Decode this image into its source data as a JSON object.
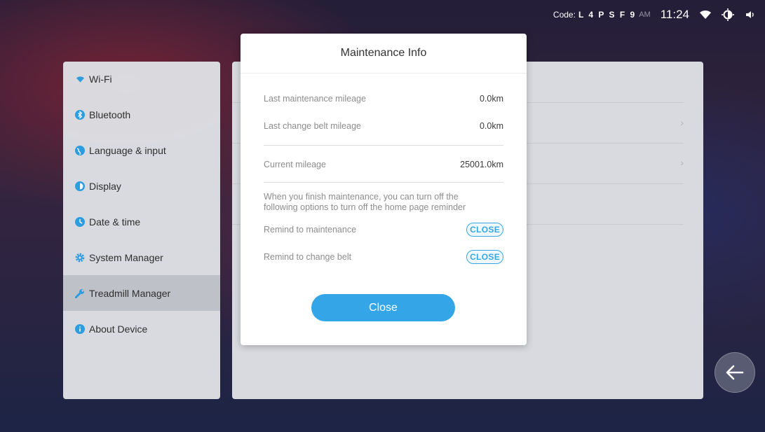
{
  "status_bar": {
    "code_label": "Code:",
    "code_value": "L 4 P S F 9",
    "am_pm": "AM",
    "time": "11:24",
    "icons": [
      "wifi-icon",
      "brightness-icon",
      "volume-icon"
    ]
  },
  "sidebar": {
    "items": [
      {
        "label": "Wi-Fi",
        "icon": "wifi-icon"
      },
      {
        "label": "Bluetooth",
        "icon": "bluetooth-icon"
      },
      {
        "label": "Language & input",
        "icon": "globe-icon"
      },
      {
        "label": "Display",
        "icon": "display-icon"
      },
      {
        "label": "Date & time",
        "icon": "clock-icon"
      },
      {
        "label": "System Manager",
        "icon": "gear-icon"
      },
      {
        "label": "Treadmill Manager",
        "icon": "wrench-icon",
        "active": true
      },
      {
        "label": "About Device",
        "icon": "info-icon"
      }
    ]
  },
  "dialog": {
    "title": "Maintenance Info",
    "last_maintenance_label": "Last maintenance mileage",
    "last_maintenance_value": "0.0km",
    "last_belt_label": "Last change belt mileage",
    "last_belt_value": "0.0km",
    "current_label": "Current mileage",
    "current_value": "25001.0km",
    "note_line1": "When you finish maintenance, you can turn off the",
    "note_line2": "following options to turn off the home page reminder",
    "remind_maintenance_label": "Remind to maintenance",
    "remind_maintenance_state": "CLOSE",
    "remind_belt_label": "Remind to change belt",
    "remind_belt_state": "CLOSE",
    "close_button": "Close"
  },
  "colors": {
    "accent": "#34a6e8",
    "panel": "#dee0e4",
    "active_item": "#bec0c6"
  }
}
